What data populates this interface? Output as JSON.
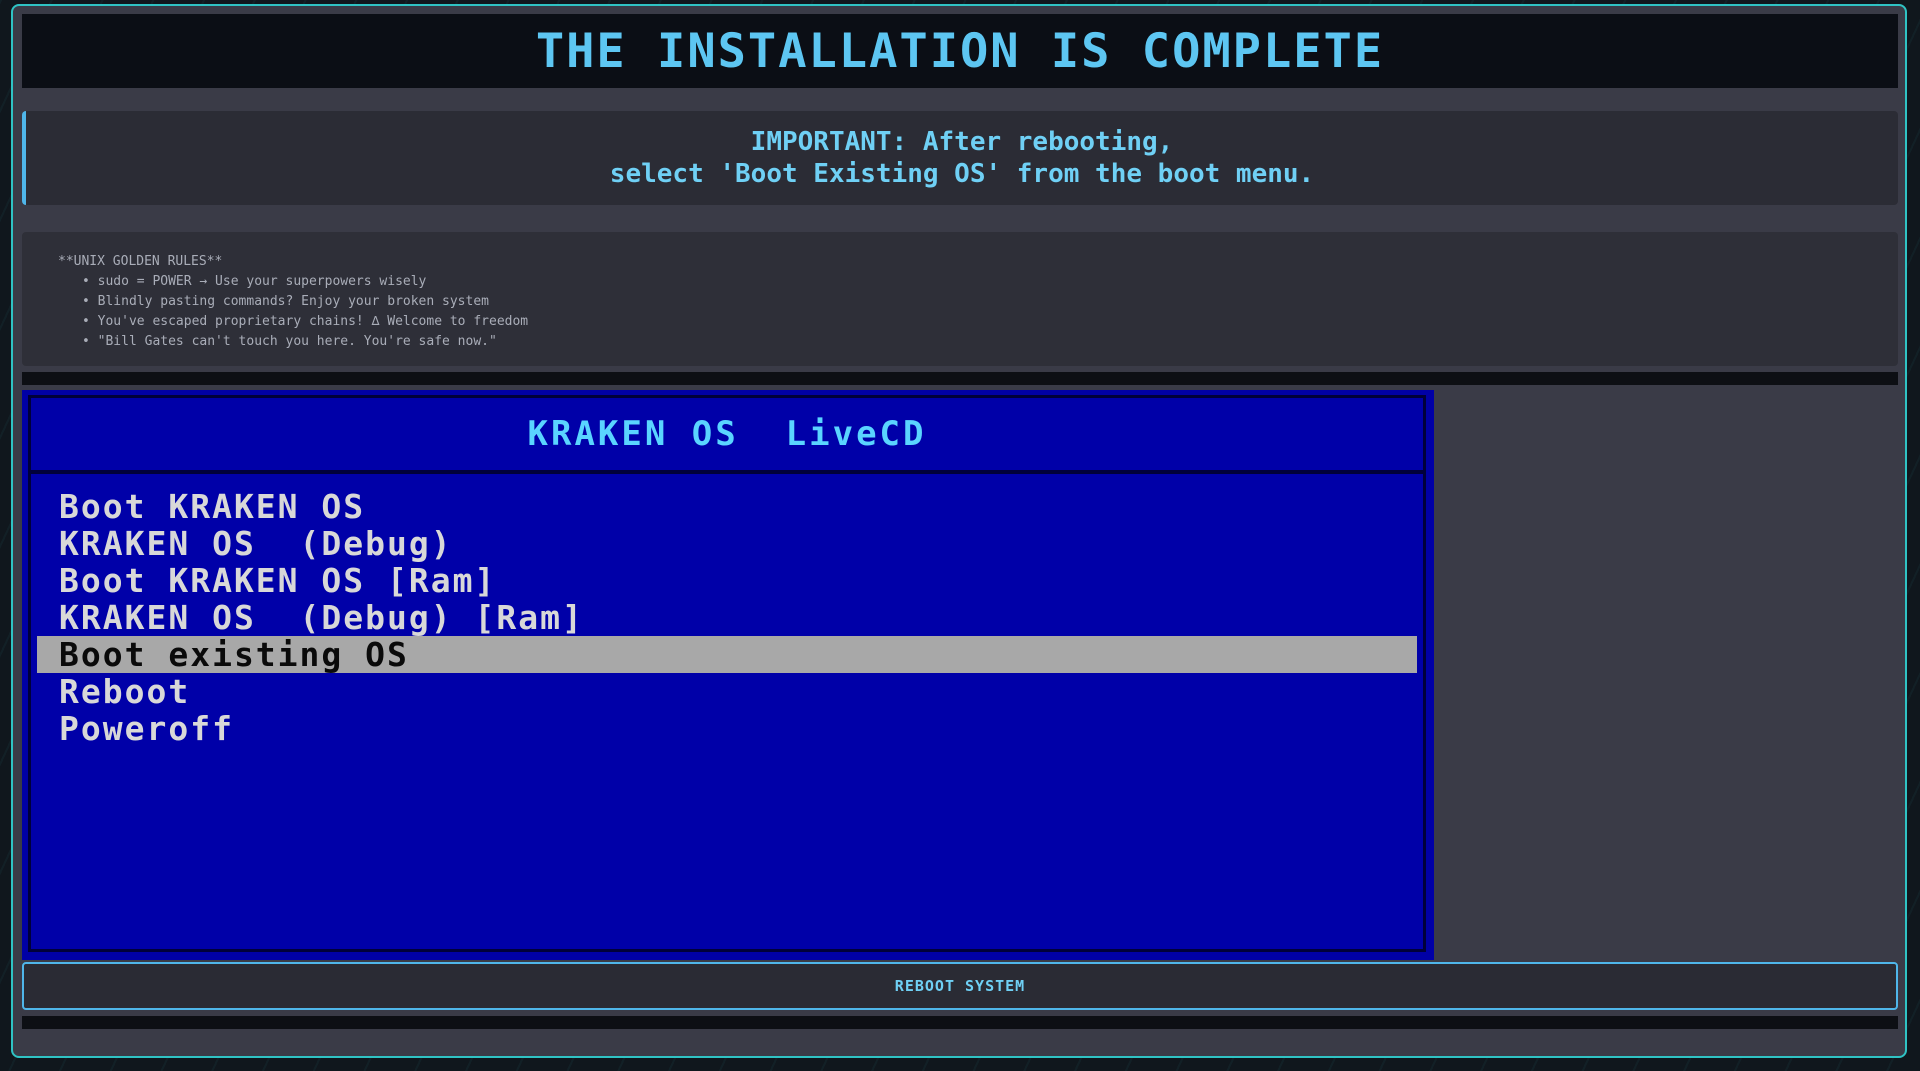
{
  "title": "THE INSTALLATION IS COMPLETE",
  "notice": {
    "line1": "IMPORTANT: After rebooting,",
    "line2": "select 'Boot Existing OS' from the boot menu."
  },
  "rules": {
    "heading": "**UNIX GOLDEN RULES**",
    "items": [
      "sudo = POWER → Use your superpowers wisely",
      "Blindly pasting commands? Enjoy your broken system",
      "You've escaped proprietary chains! ∆ Welcome to freedom",
      "\"Bill Gates can't touch you here. You're safe now.\""
    ]
  },
  "boot_menu": {
    "header": "KRAKEN OS  LiveCD",
    "items": [
      "Boot KRAKEN OS",
      "KRAKEN OS  (Debug)",
      "Boot KRAKEN OS [Ram]",
      "KRAKEN OS  (Debug) [Ram]",
      "Boot existing OS",
      "Reboot",
      "Poweroff"
    ],
    "selected_index": 4
  },
  "reboot_button": "REBOOT SYSTEM",
  "colors": {
    "accent": "#5dc6f2",
    "frame_border": "#2fc3c4",
    "boot_bg": "#0000a8",
    "boot_selected": "#a8a8a8"
  }
}
